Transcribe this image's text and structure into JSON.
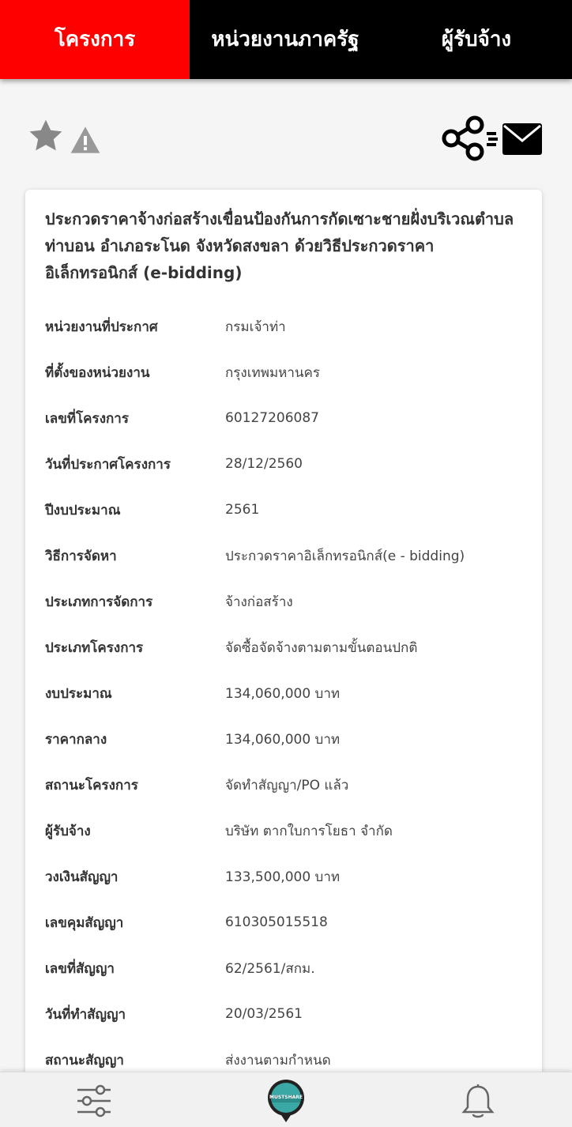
{
  "tabs": [
    {
      "label": "โครงการ",
      "active": true
    },
    {
      "label": "หน่วยงานภาครัฐ",
      "active": false
    },
    {
      "label": "ผู้รับจ้าง",
      "active": false
    }
  ],
  "colors": {
    "tab_active": "#ff0000",
    "tab_bar": "#000000",
    "icon_gray": "#888888"
  },
  "actions": {
    "favorite_icon": "star-icon",
    "report_icon": "warning-icon",
    "share_icon": "share-icon",
    "mail_icon": "mail-icon"
  },
  "project": {
    "title": "ประกวดราคาจ้างก่อสร้างเขื่อนป้องกันการกัดเซาะชายฝั่งบริเวณตำบลท่าบอน อำเภอระโนด จังหวัดสงขลา ด้วยวิธีประกวดราคาอิเล็กทรอนิกส์ (e-bidding)",
    "fields": [
      {
        "label": "หน่วยงานที่ประกาศ",
        "value": "กรมเจ้าท่า"
      },
      {
        "label": "ที่ตั้งของหน่วยงาน",
        "value": "กรุงเทพมหานคร"
      },
      {
        "label": "เลขที่โครงการ",
        "value": "60127206087"
      },
      {
        "label": "วันที่ประกาศโครงการ",
        "value": "28/12/2560"
      },
      {
        "label": "ปีงบประมาณ",
        "value": "2561"
      },
      {
        "label": "วิธีการจัดหา",
        "value": "ประกวดราคาอิเล็กทรอนิกส์(e - bidding)"
      },
      {
        "label": "ประเภทการจัดการ",
        "value": "จ้างก่อสร้าง"
      },
      {
        "label": "ประเภทโครงการ",
        "value": "จัดซื้อจัดจ้างตามตามขั้นตอนปกติ"
      },
      {
        "label": "งบประมาณ",
        "value": "134,060,000 บาท"
      },
      {
        "label": "ราคากลาง",
        "value": "134,060,000 บาท"
      },
      {
        "label": "สถานะโครงการ",
        "value": "จัดทำสัญญา/PO แล้ว"
      },
      {
        "label": "ผู้รับจ้าง",
        "value": "บริษัท ตากใบการโยธา จำกัด"
      },
      {
        "label": "วงเงินสัญญา",
        "value": "133,500,000 บาท"
      },
      {
        "label": "เลขคุมสัญญา",
        "value": "610305015518"
      },
      {
        "label": "เลขที่สัญญา",
        "value": "62/2561/สกม."
      },
      {
        "label": "วันที่ทำสัญญา",
        "value": "20/03/2561"
      },
      {
        "label": "สถานะสัญญา",
        "value": "ส่งงานตามกำหนด"
      }
    ]
  },
  "bottom_nav": {
    "filter_icon": "filter-icon",
    "logo_text": "MUSTSHARE",
    "bell_icon": "bell-icon"
  }
}
